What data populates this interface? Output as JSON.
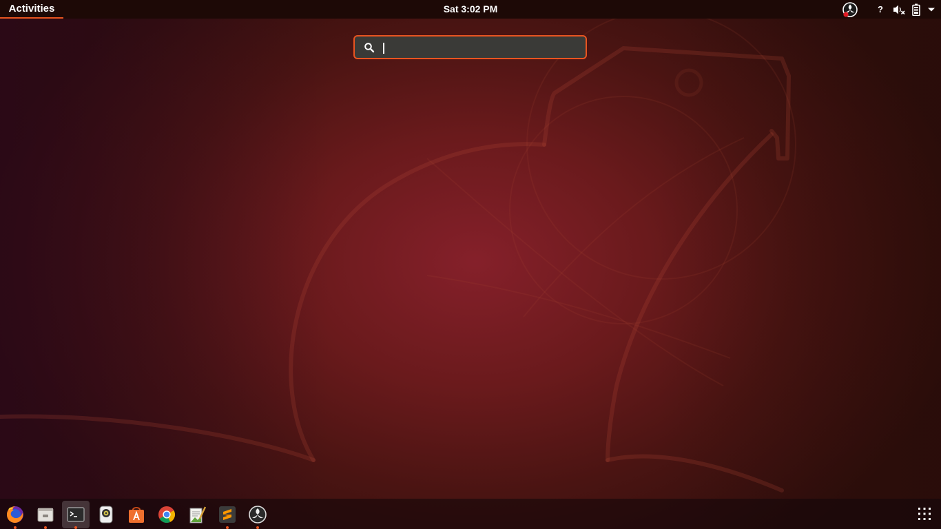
{
  "top_bar": {
    "activities_label": "Activities",
    "clock": "Sat  3:02 PM",
    "tray": {
      "help_label": "?",
      "icons": [
        "obs-recording-icon",
        "help-icon",
        "volume-muted-icon",
        "battery-icon",
        "system-menu-arrow-icon"
      ]
    }
  },
  "search": {
    "value": "",
    "placeholder": ""
  },
  "dock": {
    "apps": [
      {
        "name": "Firefox",
        "icon": "firefox-icon",
        "running": true
      },
      {
        "name": "Files",
        "icon": "files-icon",
        "running": true
      },
      {
        "name": "Terminal",
        "icon": "terminal-icon",
        "running": true,
        "active": true
      },
      {
        "name": "Camera",
        "icon": "camera-app-icon",
        "running": false
      },
      {
        "name": "Ubuntu Software",
        "icon": "ubuntu-software-icon",
        "running": false
      },
      {
        "name": "Google Chrome",
        "icon": "chrome-icon",
        "running": false
      },
      {
        "name": "Text Editor",
        "icon": "text-editor-icon",
        "running": false
      },
      {
        "name": "Sublime Text",
        "icon": "sublime-text-icon",
        "running": true
      },
      {
        "name": "OBS Studio",
        "icon": "obs-studio-icon",
        "running": true
      }
    ],
    "show_apps_icon": "grid-icon"
  },
  "colors": {
    "accent": "#e95420",
    "top_bar": "#1d0906",
    "wallpaper_center": "#85202a",
    "wallpaper_edge": "#2e0e0c"
  }
}
